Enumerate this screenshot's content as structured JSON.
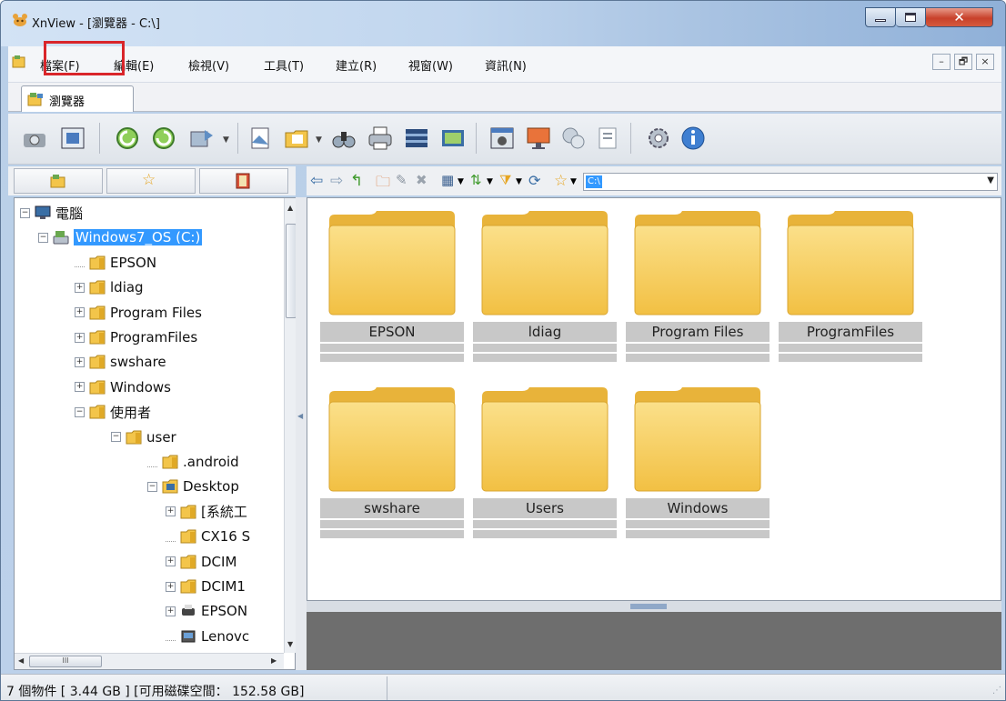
{
  "window": {
    "title": "XnView - [瀏覽器 - C:\\]",
    "accent": "#3399ff",
    "highlight_color": "#d9252a"
  },
  "menubar": {
    "items": [
      "檔案(F)",
      "編輯(E)",
      "檢視(V)",
      "工具(T)",
      "建立(R)",
      "視窗(W)",
      "資訊(N)"
    ],
    "mdi": {
      "minimize": "–",
      "restore": "🗗",
      "close": "×"
    }
  },
  "tab": {
    "label": "瀏覽器"
  },
  "toolbar": {
    "icons": [
      "scan-icon",
      "fullscreen-icon",
      "rotate-left-icon",
      "rotate-right-icon",
      "convert-icon",
      "open-icon",
      "open-folder-icon",
      "find-icon",
      "print-icon",
      "batch-icon",
      "slideshow-icon",
      "capture-icon",
      "desktop-icon",
      "network-icon",
      "properties-icon",
      "settings-icon",
      "info-icon"
    ]
  },
  "nav": {
    "path": "C:\\",
    "icons": [
      "back-icon",
      "forward-icon",
      "up-icon",
      "new-folder-icon",
      "rename-icon",
      "delete-icon",
      "view-mode-icon",
      "sort-icon",
      "filter-icon",
      "refresh-icon",
      "favorite-icon"
    ]
  },
  "tree": {
    "items": [
      {
        "label": "電腦",
        "level": 0,
        "exp": "−",
        "type": "computer"
      },
      {
        "label": "Windows7_OS (C:)",
        "level": 1,
        "exp": "−",
        "type": "drive",
        "selected": true
      },
      {
        "label": "EPSON",
        "level": 2,
        "exp": "",
        "type": "folder"
      },
      {
        "label": "ldiag",
        "level": 2,
        "exp": "+",
        "type": "folder"
      },
      {
        "label": "Program Files",
        "level": 2,
        "exp": "+",
        "type": "folder"
      },
      {
        "label": "ProgramFiles",
        "level": 2,
        "exp": "+",
        "type": "folder"
      },
      {
        "label": "swshare",
        "level": 2,
        "exp": "+",
        "type": "folder"
      },
      {
        "label": "Windows",
        "level": 2,
        "exp": "+",
        "type": "folder"
      },
      {
        "label": "使用者",
        "level": 2,
        "exp": "−",
        "type": "folder"
      },
      {
        "label": "user",
        "level": 3,
        "exp": "−",
        "type": "folder"
      },
      {
        "label": ".android",
        "level": 4,
        "exp": "",
        "type": "folder"
      },
      {
        "label": "Desktop",
        "level": 4,
        "exp": "−",
        "type": "desktop"
      },
      {
        "label": "[系統工",
        "level": 5,
        "exp": "+",
        "type": "folder"
      },
      {
        "label": "CX16 S",
        "level": 5,
        "exp": "",
        "type": "folder"
      },
      {
        "label": "DCIM",
        "level": 5,
        "exp": "+",
        "type": "folder"
      },
      {
        "label": "DCIM1",
        "level": 5,
        "exp": "+",
        "type": "folder"
      },
      {
        "label": "EPSON",
        "level": 5,
        "exp": "+",
        "type": "printer"
      },
      {
        "label": "Lenovc",
        "level": 5,
        "exp": "",
        "type": "device"
      }
    ],
    "hscroll_grip": "III"
  },
  "files": [
    {
      "name": "EPSON"
    },
    {
      "name": "ldiag"
    },
    {
      "name": "Program Files"
    },
    {
      "name": "ProgramFiles"
    },
    {
      "name": "swshare"
    },
    {
      "name": "Users"
    },
    {
      "name": "Windows"
    }
  ],
  "status": {
    "text": "7 個物件 [ 3.44 GB ] [可用磁碟空間： 152.58 GB]"
  }
}
